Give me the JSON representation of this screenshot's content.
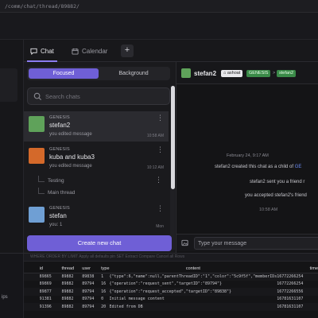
{
  "browser": {
    "url": "/comm/chat/thread/89882/"
  },
  "tabs": [
    {
      "label": "Chat",
      "icon": "chat-bubble-icon"
    },
    {
      "label": "Calendar",
      "icon": "calendar-icon"
    },
    {
      "label": "+",
      "icon": "plus-icon"
    }
  ],
  "list": {
    "segment": {
      "focused": "Focused",
      "background": "Background"
    },
    "search_placeholder": "Search chats",
    "create_label": "Create new chat",
    "items": [
      {
        "group": "GENESIS",
        "name": "stefan2",
        "preview": "you edited message",
        "time": "10:58 AM",
        "color": "#5fa25a"
      },
      {
        "group": "GENESIS",
        "name": "kuba and kuba3",
        "preview": "you edited message",
        "time": "10:12 AM",
        "color": "#d4692a"
      },
      {
        "group": "GENESIS",
        "name": "stefan",
        "preview": "you: 1",
        "time": "Mon",
        "color": "#6f9fd4"
      }
    ],
    "threads": [
      "Testing",
      "Main thread"
    ]
  },
  "conversation": {
    "name": "stefan2",
    "badges": [
      "ashoat",
      "GENESIS",
      ">",
      "stefan2"
    ],
    "date": "February 24, 9:17 AM",
    "lines": [
      {
        "text": "stefan2 created this chat as a child of ",
        "link": "GE"
      },
      {
        "text": "stefan2 sent you a friend r",
        "link": ""
      },
      {
        "text": "you accepted stefan2's friend",
        "link": ""
      }
    ],
    "time": "10:58 AM",
    "composer_placeholder": "Type your message"
  },
  "db": {
    "toolbar_hint": "WHERE   ORDER BY   LIMIT   Apply all defaults   pin   SET   Extract   Compare   Cancel all   Rows",
    "left_label": "ips",
    "columns": [
      "id",
      "thread",
      "user",
      "type",
      "content",
      "time"
    ],
    "rows": [
      {
        "id": "89865",
        "thread": "89882",
        "user": "89838",
        "type": "1",
        "content": "{\"type\":6,\"name\":null,\"parentThreadID\":\"1\",\"color\":\"5c9f5f\",\"memberIDs",
        "time": "16772266254"
      },
      {
        "id": "89869",
        "thread": "89882",
        "user": "89794",
        "type": "16",
        "content": "{\"operation\":\"request_sent\",\"targetID\":\"89794\"}",
        "time": "16772266254"
      },
      {
        "id": "89877",
        "thread": "89882",
        "user": "89794",
        "type": "16",
        "content": "{\"operation\":\"request_accepted\",\"targetID\":\"89838\"}",
        "time": "16772266556"
      },
      {
        "id": "91381",
        "thread": "89882",
        "user": "89794",
        "type": "0",
        "content": "Initial message content",
        "time": "16781631107"
      },
      {
        "id": "91396",
        "thread": "89882",
        "user": "89794",
        "type": "20",
        "content": "Edited from DB",
        "time": "16781631107"
      }
    ]
  }
}
